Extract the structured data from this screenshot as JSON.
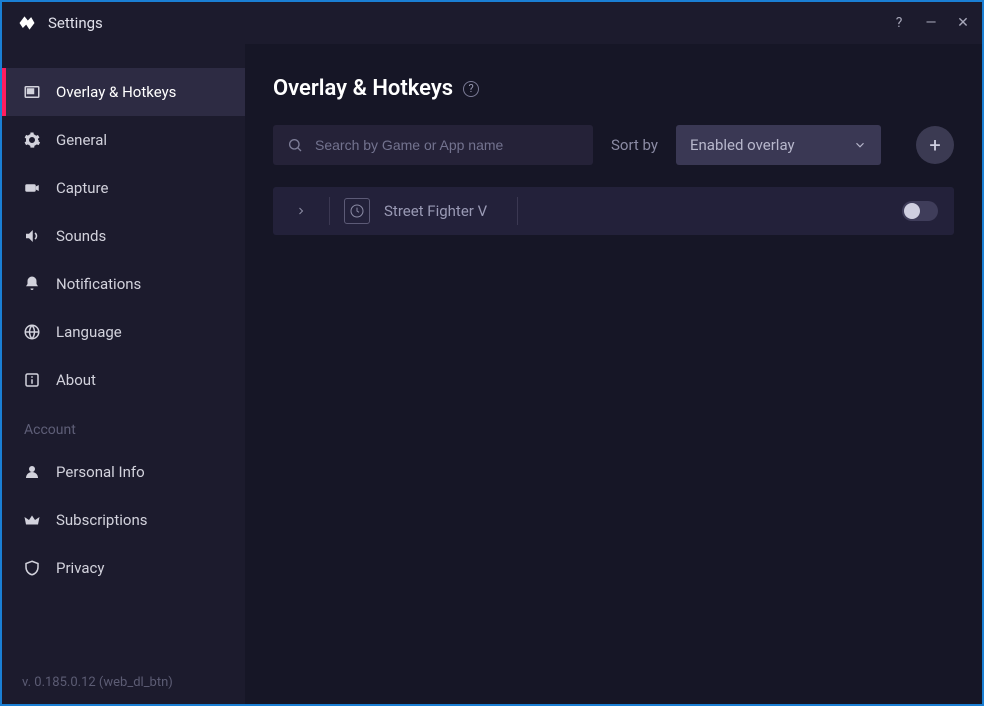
{
  "titlebar": {
    "title": "Settings"
  },
  "sidebar": {
    "items": [
      {
        "label": "Overlay & Hotkeys",
        "icon": "overlay-icon",
        "active": true
      },
      {
        "label": "General",
        "icon": "gear-icon"
      },
      {
        "label": "Capture",
        "icon": "camera-icon"
      },
      {
        "label": "Sounds",
        "icon": "speaker-icon"
      },
      {
        "label": "Notifications",
        "icon": "bell-icon"
      },
      {
        "label": "Language",
        "icon": "globe-icon"
      },
      {
        "label": "About",
        "icon": "info-icon"
      }
    ],
    "section_account_label": "Account",
    "account_items": [
      {
        "label": "Personal Info",
        "icon": "person-icon"
      },
      {
        "label": "Subscriptions",
        "icon": "crown-icon"
      },
      {
        "label": "Privacy",
        "icon": "shield-icon"
      }
    ],
    "footer_version": "v. 0.185.0.12 (web_dl_btn)"
  },
  "main": {
    "page_title": "Overlay & Hotkeys",
    "search_placeholder": "Search by Game or App name",
    "sort_by_label": "Sort by",
    "sort_selected": "Enabled overlay",
    "games": [
      {
        "name": "Street Fighter V",
        "enabled": false
      }
    ]
  }
}
